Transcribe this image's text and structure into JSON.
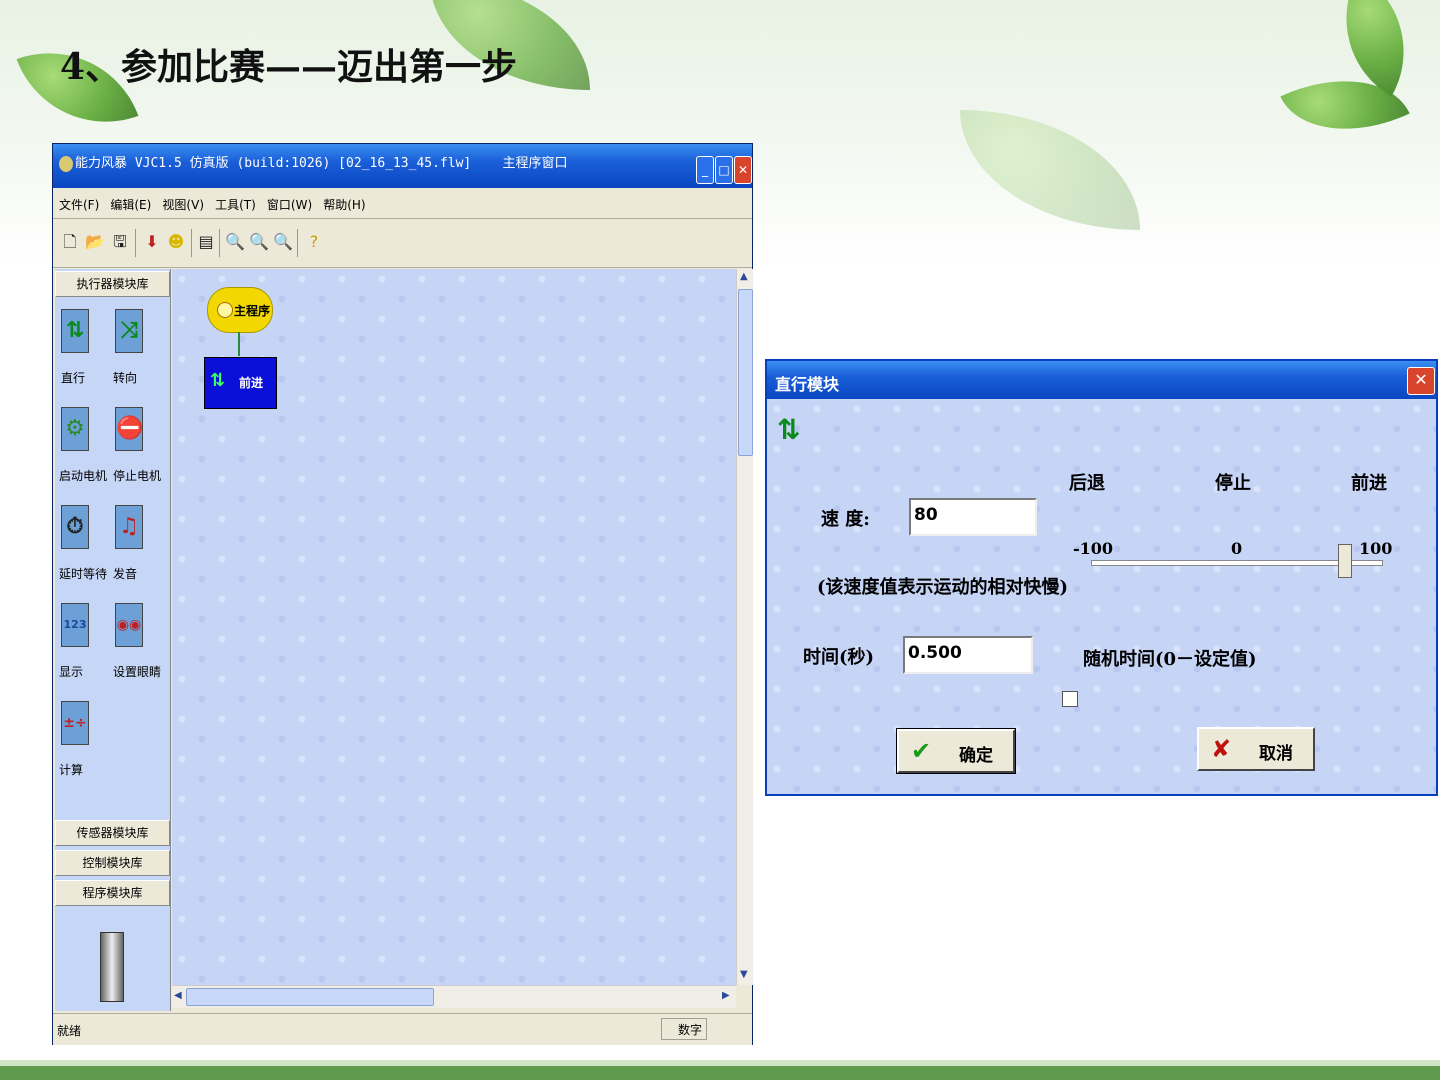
{
  "slide": {
    "title": "4、参加比赛——迈出第一步"
  },
  "app": {
    "window_title": "能力风暴 VJC1.5 仿真版 (build:1026) [02_16_13_45.flw]    主程序窗口",
    "menu": [
      "文件(F)",
      "编辑(E)",
      "视图(V)",
      "工具(T)",
      "窗口(W)",
      "帮助(H)"
    ],
    "toolbar_icons": [
      "new-file-icon",
      "open-folder-icon",
      "save-icon",
      "download-icon",
      "run-icon",
      "properties-icon",
      "zoom-out-icon",
      "zoom-reset-icon",
      "zoom-in-icon",
      "help-icon"
    ],
    "libraries": {
      "actuator": "执行器模块库",
      "sensor": "传感器模块库",
      "control": "控制模块库",
      "program": "程序模块库"
    },
    "blocks": [
      {
        "label": "直行",
        "icon": "straight-arrows-icon"
      },
      {
        "label": "转向",
        "icon": "turn-arrows-icon"
      },
      {
        "label": "启动电机",
        "icon": "motor-start-icon"
      },
      {
        "label": "停止电机",
        "icon": "motor-stop-icon"
      },
      {
        "label": "延时等待",
        "icon": "delay-timer-icon"
      },
      {
        "label": "发音",
        "icon": "sound-icon"
      },
      {
        "label": "显示",
        "icon": "display-123-icon"
      },
      {
        "label": "设置眼睛",
        "icon": "eyes-icon"
      },
      {
        "label": "计算",
        "icon": "calculate-icon"
      }
    ],
    "flow": {
      "main_node": "主程序",
      "forward_node": "前进"
    },
    "status": {
      "left": "就绪",
      "right": "数字"
    }
  },
  "dialog": {
    "title": "直行模块",
    "speed_label": "速 度:",
    "speed_value": "80",
    "slider": {
      "left_label": "后退",
      "mid_label": "停止",
      "right_label": "前进",
      "min": "-100",
      "mid": "0",
      "max": "100",
      "value": 80
    },
    "speed_note": "(该速度值表示运动的相对快慢)",
    "time_label": "时间(秒)",
    "time_value": "0.500",
    "random_label": "随机时间(0－设定值)",
    "random_checked": false,
    "ok_label": "确定",
    "cancel_label": "取消"
  }
}
